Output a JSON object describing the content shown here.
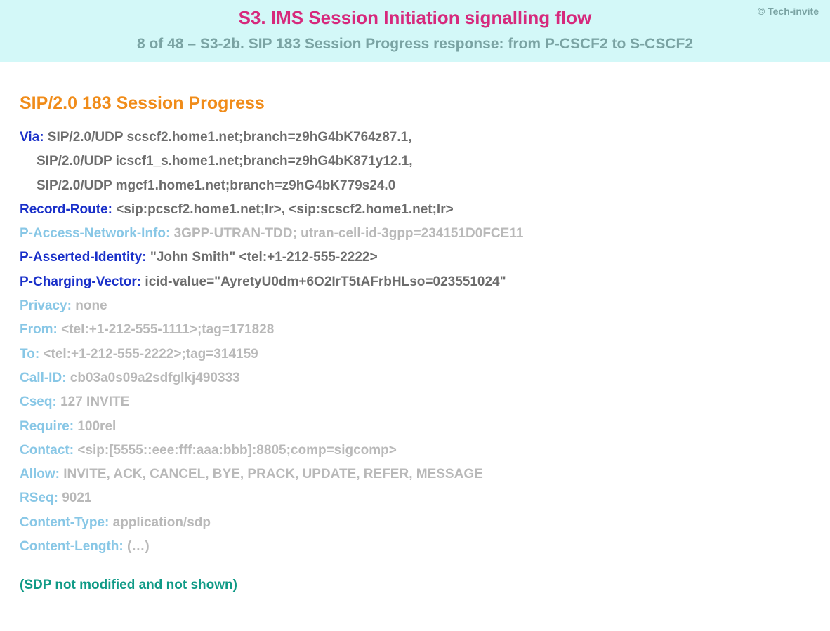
{
  "header": {
    "copyright": "© Tech-invite",
    "title": "S3. IMS Session Initiation signalling flow",
    "subtitle": "8 of 48 – S3-2b. SIP 183 Session Progress response: from P-CSCF2 to S-CSCF2"
  },
  "sip": {
    "status_line": "SIP/2.0 183 Session Progress",
    "via": {
      "name": "Via",
      "line1": "SIP/2.0/UDP scscf2.home1.net;branch=z9hG4bK764z87.1,",
      "line2": "SIP/2.0/UDP icscf1_s.home1.net;branch=z9hG4bK871y12.1,",
      "line3": "SIP/2.0/UDP mgcf1.home1.net;branch=z9hG4bK779s24.0"
    },
    "record_route": {
      "name": "Record-Route",
      "value": "<sip:pcscf2.home1.net;lr>, <sip:scscf2.home1.net;lr>"
    },
    "p_access_network_info": {
      "name": "P-Access-Network-Info",
      "value": "3GPP-UTRAN-TDD; utran-cell-id-3gpp=234151D0FCE11"
    },
    "p_asserted_identity": {
      "name": "P-Asserted-Identity",
      "value": "\"John Smith\" <tel:+1-212-555-2222>"
    },
    "p_charging_vector": {
      "name": "P-Charging-Vector",
      "value": "icid-value=\"AyretyU0dm+6O2IrT5tAFrbHLso=023551024\""
    },
    "privacy": {
      "name": "Privacy",
      "value": "none"
    },
    "from": {
      "name": "From",
      "value": "<tel:+1-212-555-1111>;tag=171828"
    },
    "to": {
      "name": "To",
      "value": "<tel:+1-212-555-2222>;tag=314159"
    },
    "call_id": {
      "name": "Call-ID",
      "value": "cb03a0s09a2sdfglkj490333"
    },
    "cseq": {
      "name": "Cseq",
      "value": "127 INVITE"
    },
    "require": {
      "name": "Require",
      "value": "100rel"
    },
    "contact": {
      "name": "Contact",
      "value": "<sip:[5555::eee:fff:aaa:bbb]:8805;comp=sigcomp>"
    },
    "allow": {
      "name": "Allow",
      "value": "INVITE, ACK, CANCEL, BYE, PRACK, UPDATE, REFER, MESSAGE"
    },
    "rseq": {
      "name": "RSeq",
      "value": "9021"
    },
    "content_type": {
      "name": "Content-Type",
      "value": "application/sdp"
    },
    "content_length": {
      "name": "Content-Length",
      "value": "(…)"
    },
    "sdp_note": "(SDP not modified and not shown)"
  }
}
